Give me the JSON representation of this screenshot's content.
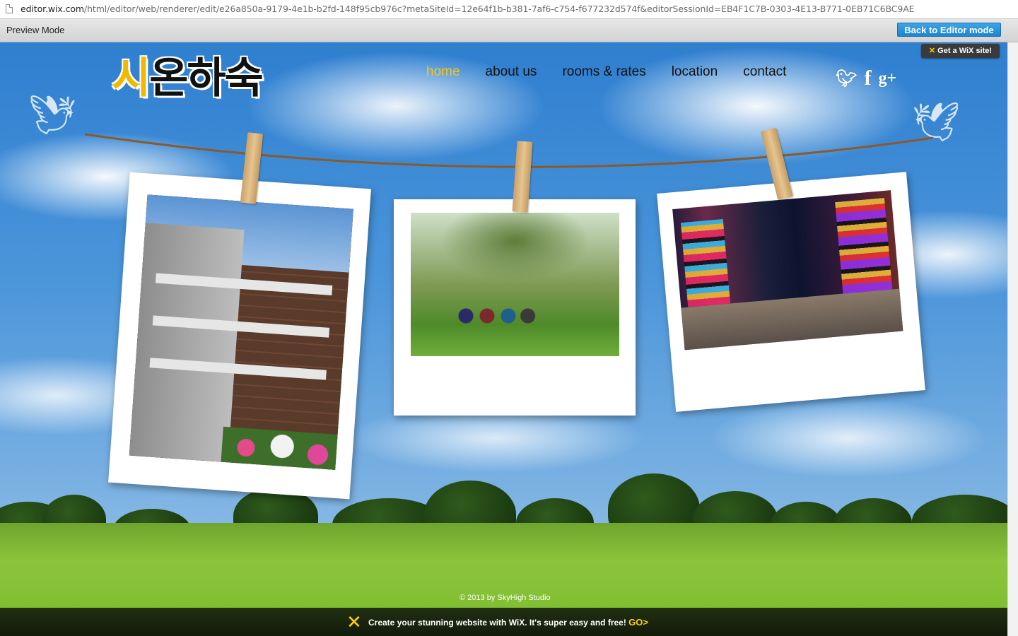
{
  "browser": {
    "url_host": "editor.wix.com",
    "url_path": "/html/editor/web/renderer/edit/e26a850a-9179-4e1b-b2fd-148f95cb976c?metaSiteId=12e64f1b-b381-7af6-c754-f677232d574f&editorSessionId=EB4F1C7B-0303-4E13-B771-0EB71C6BC9AE"
  },
  "preview_bar": {
    "label": "Preview Mode",
    "back_button": "Back to Editor mode"
  },
  "site": {
    "logo_first": "시",
    "logo_rest": "온하숙",
    "get_wix_badge": "Get a WiX site!",
    "nav": [
      {
        "label": "home",
        "active": true
      },
      {
        "label": "about us",
        "active": false
      },
      {
        "label": "rooms & rates",
        "active": false
      },
      {
        "label": "location",
        "active": false
      },
      {
        "label": "contact",
        "active": false
      }
    ],
    "social_icons": [
      "twitter-icon",
      "facebook-icon",
      "google-plus-icon"
    ],
    "copyright": "© 2013 by SkyHigh Studio"
  },
  "wix_banner": {
    "text": "Create your stunning website with WiX. It's super easy and free!",
    "go": "GO>"
  },
  "colors": {
    "nav_active": "#f5c518",
    "editor_button": "#1e86cf"
  }
}
